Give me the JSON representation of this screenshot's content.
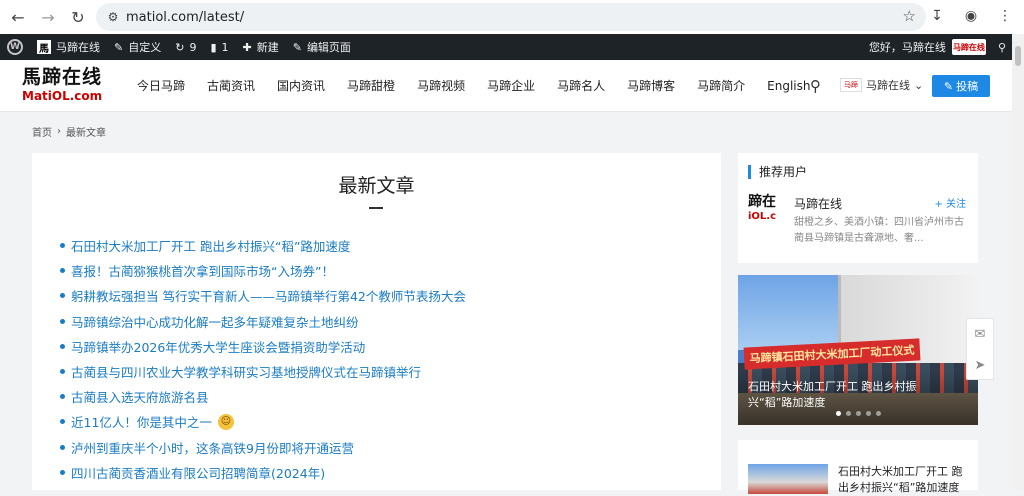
{
  "browser": {
    "url": "matiol.com/latest/",
    "icons": {
      "back": "back-arrow-icon",
      "forward": "forward-arrow-icon",
      "reload": "reload-icon",
      "star": "star-icon",
      "download": "download-icon",
      "profile": "profile-icon",
      "menu": "kebab-menu-icon"
    }
  },
  "adminbar": {
    "site_name": "马蹄在线",
    "customize": "自定义",
    "updates_count": "9",
    "comments_count": "1",
    "new_label": "新建",
    "edit_page": "编辑页面",
    "greeting": "您好，马蹄在线",
    "avatar_text": "马蹄在线"
  },
  "header": {
    "logo_cn": "馬蹄在线",
    "logo_en": "MatiOL.com",
    "nav": [
      "今日马蹄",
      "古蔺资讯",
      "国内资讯",
      "马蹄甜橙",
      "马蹄视频",
      "马蹄企业",
      "马蹄名人",
      "马蹄博客",
      "马蹄简介",
      "English"
    ],
    "user_name": "马蹄在线",
    "user_mini": "马蹄",
    "contribute": "投稿"
  },
  "breadcrumb": {
    "home": "首页",
    "current": "最新文章"
  },
  "main": {
    "title": "最新文章",
    "articles": [
      "石田村大米加工厂开工 跑出乡村振兴“稻”路加速度",
      "喜报！古蔺猕猴桃首次拿到国际市场“入场券”！",
      "躬耕教坛强担当 笃行实干育新人——马蹄镇举行第42个教师节表扬大会",
      "马蹄镇综治中心成功化解一起多年疑难复杂土地纠纷",
      "马蹄镇举办2026年优秀大学生座谈会暨捐资助学活动",
      "古蔺县与四川农业大学教学科研实习基地授牌仪式在马蹄镇举行",
      "古蔺县入选天府旅游名县",
      "近11亿人！你是其中之一",
      "泸州到重庆半个小时，这条高铁9月份即将开通运营",
      "四川古蔺贡香酒业有限公司招聘简章(2024年)"
    ],
    "emoji_article_index": 7
  },
  "sidebar": {
    "recommend_title": "推荐用户",
    "user": {
      "avatar_line1": "蹄在",
      "avatar_line2": "iOL.c",
      "name": "马蹄在线",
      "follow": "+ 关注",
      "desc": "甜橙之乡、美酒小镇：四川省泸州市古蔺县马蹄镇是古聋源地、奢..."
    },
    "slider": {
      "banner": "马蹄镇石田村大米加工厂动工仪式",
      "caption": "石田村大米加工厂开工 跑出乡村振兴“稻”路加速度",
      "slides": 5,
      "active_slide": 1
    },
    "post": {
      "title": "石田村大米加工厂开工 跑出乡村振兴“稻”路加速度"
    }
  },
  "colors": {
    "accent": "#1e88e5",
    "link": "#1a7cc4",
    "adminbar": "#1d2327",
    "brand_red": "#cc0000"
  }
}
